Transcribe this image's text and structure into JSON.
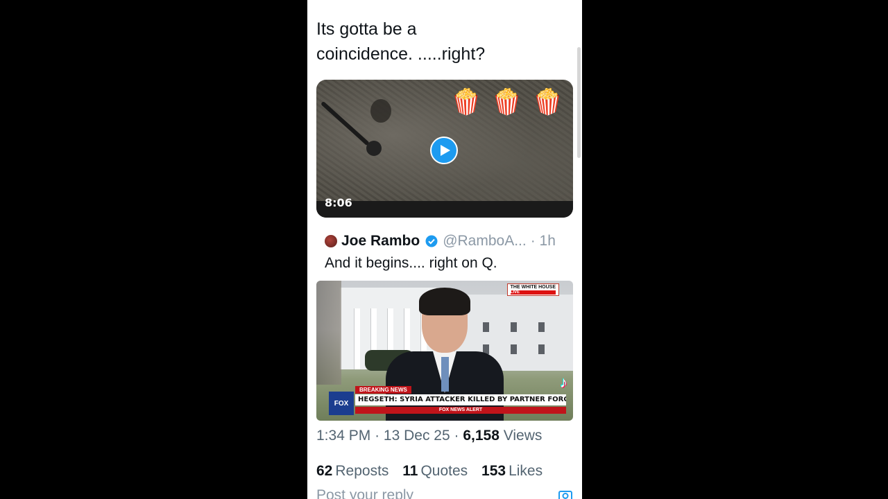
{
  "tweet": {
    "text": "Its gotta be a\ncoincidence.  .....right?",
    "video": {
      "duration": "8:06",
      "emojis": [
        "🍿",
        "🍿",
        "🍿"
      ]
    }
  },
  "quoted": {
    "name": "Joe Rambo",
    "handle": "@RamboA...",
    "time": "· 1h",
    "text": "And it begins.... right on Q.",
    "media": {
      "live_label": "THE WHITE HOUSE",
      "live_sub": "LIVE",
      "breaking": "BREAKING NEWS",
      "headline": "HEGSETH: SYRIA ATTACKER KILLED BY PARTNER FORCES",
      "alert": "FOX NEWS ALERT",
      "logo": "FOX",
      "tiktok": "♪"
    }
  },
  "meta": {
    "time": "1:34 PM",
    "sep1": "·",
    "date": "13 Dec 25",
    "sep2": "·",
    "views_count": "6,158",
    "views_label": "Views"
  },
  "stats": {
    "reposts_count": "62",
    "reposts_label": "Reposts",
    "quotes_count": "11",
    "quotes_label": "Quotes",
    "likes_count": "153",
    "likes_label": "Likes"
  },
  "reply": {
    "placeholder": "Post your reply"
  },
  "colors": {
    "accent": "#1d9bf0",
    "text": "#0f1419",
    "muted": "#536471"
  }
}
